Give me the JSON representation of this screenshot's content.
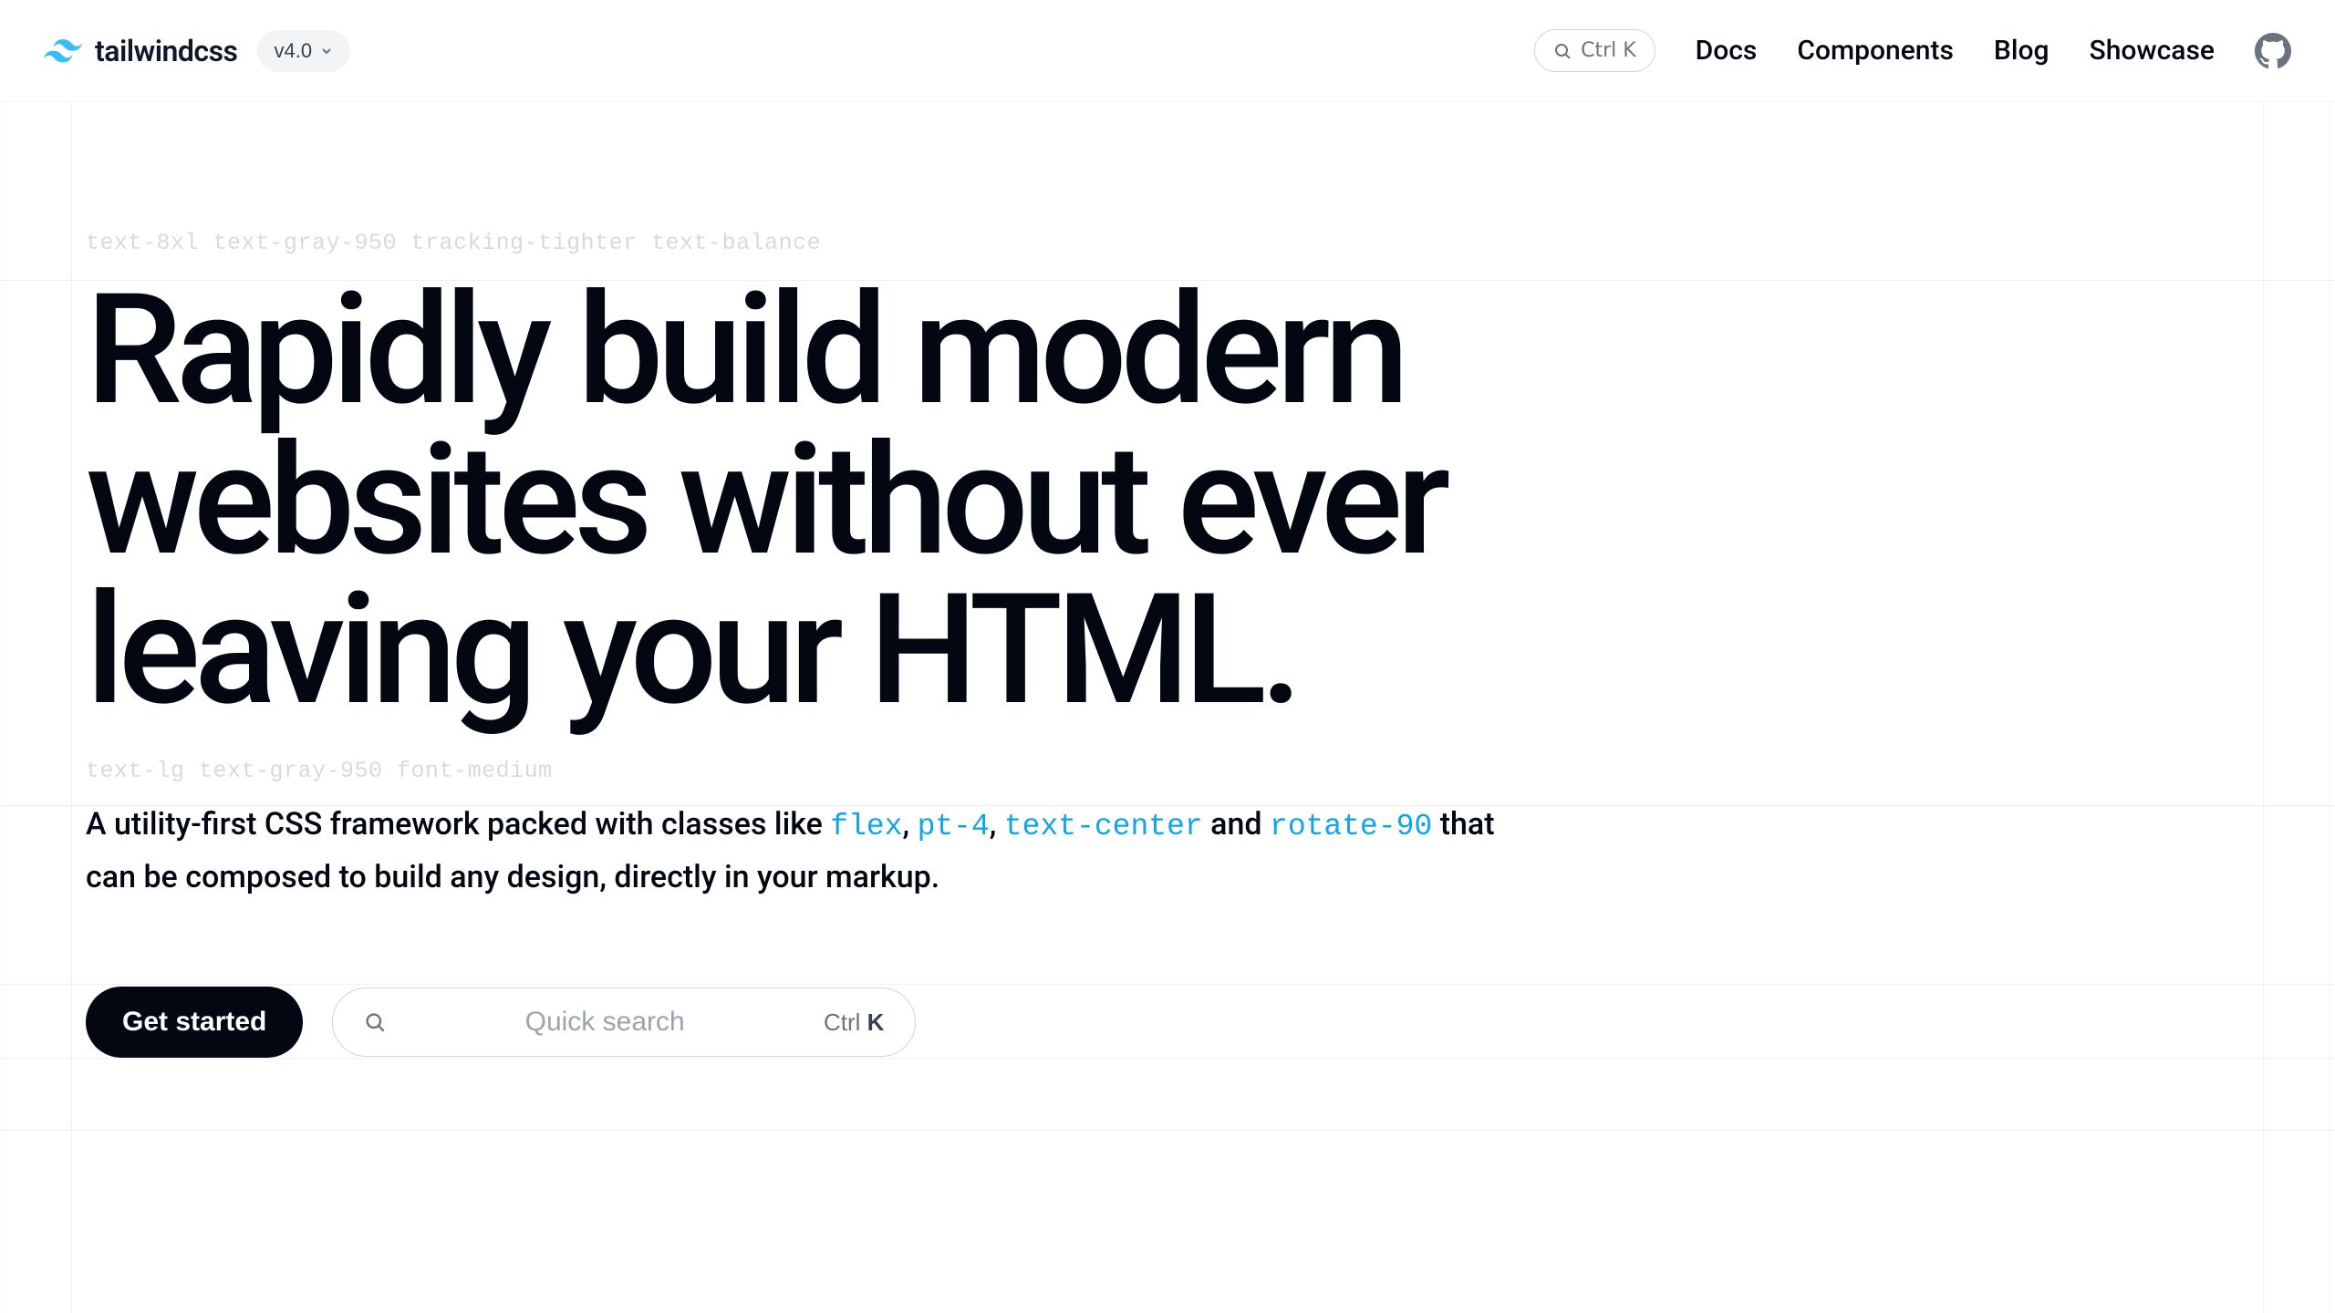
{
  "header": {
    "brand": "tailwindcss",
    "version_label": "v4.0",
    "search_kbd": "Ctrl K",
    "nav": {
      "docs": "Docs",
      "components": "Components",
      "blog": "Blog",
      "showcase": "Showcase"
    }
  },
  "hero": {
    "annotation_title": "text-8xl text-gray-950 tracking-tighter text-balance",
    "title": "Rapidly build modern websites without ever leaving your HTML.",
    "annotation_desc": "text-lg text-gray-950 font-medium",
    "desc_pre": "A utility-first CSS framework packed with classes like ",
    "tokens": {
      "t1": "flex",
      "sep1": ", ",
      "t2": "pt-4",
      "sep2": ", ",
      "t3": "text-center"
    },
    "desc_mid": " and ",
    "token4": "rotate-90",
    "desc_post": " that can be composed to build any design, directly in your markup.",
    "cta_label": "Get started",
    "quick_search_placeholder": "Quick search",
    "quick_search_kbd_prefix": "Ctrl ",
    "quick_search_kbd_key": "K"
  }
}
